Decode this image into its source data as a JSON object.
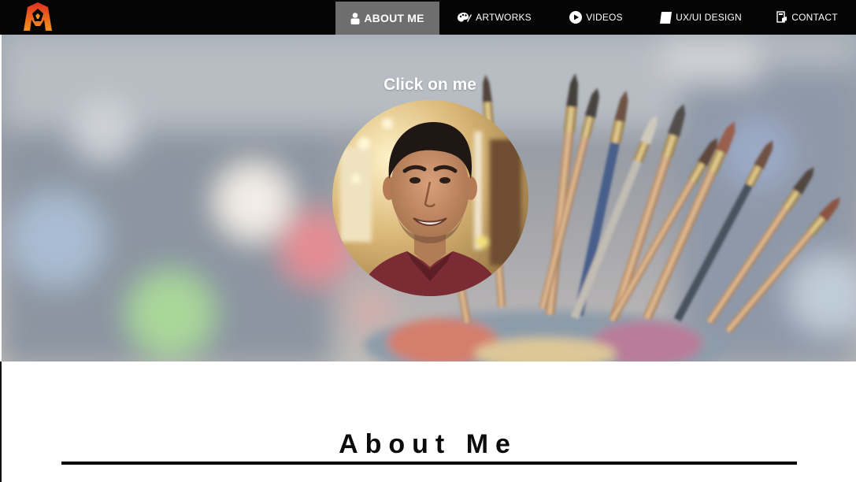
{
  "navbar": {
    "logo": "monogram-logo",
    "items": [
      {
        "label": "ABOUT ME",
        "icon": "person-icon",
        "active": true
      },
      {
        "label": "ARTWORKS",
        "icon": "palette-icon",
        "active": false
      },
      {
        "label": "VIDEOS",
        "icon": "play-icon",
        "active": false
      },
      {
        "label": "UX/UI DESIGN",
        "icon": "page-icon",
        "active": false
      },
      {
        "label": "CONTACT",
        "icon": "contact-icon",
        "active": false
      }
    ]
  },
  "hero": {
    "caption": "Click on me",
    "background_image": "paintbrushes-in-jar-bokeh",
    "avatar_image": "profile-photo-man-smiling"
  },
  "about": {
    "title": "About Me"
  },
  "colors": {
    "nav_background": "#050505",
    "nav_active": "#6e6e6e",
    "nav_text": "#ffffff",
    "logo_red": "#e0301e",
    "logo_orange": "#f7941d",
    "heading_text": "#0b0b0b"
  }
}
